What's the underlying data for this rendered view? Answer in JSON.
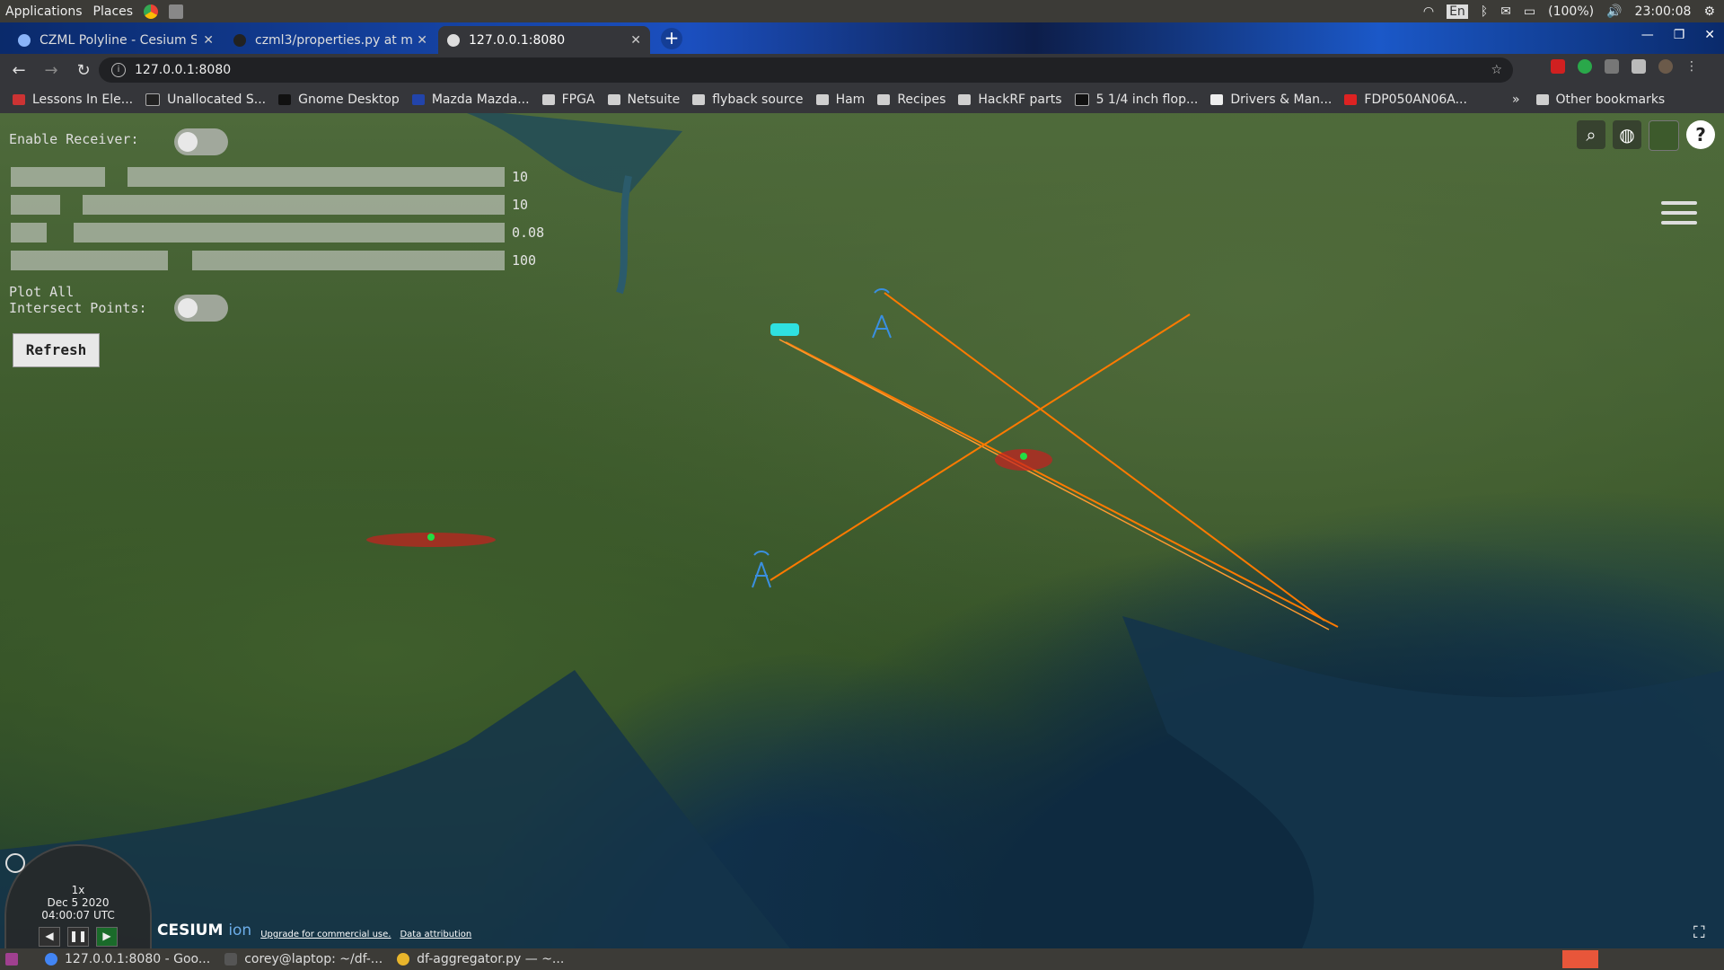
{
  "system_bar": {
    "applications_label": "Applications",
    "places_label": "Places",
    "keyboard_layout": "En",
    "battery": "(100%)",
    "clock": "23:00:08"
  },
  "tabs": [
    {
      "title": "CZML Polyline - Cesium Sa",
      "active": false
    },
    {
      "title": "czml3/properties.py at m",
      "active": false
    },
    {
      "title": "127.0.0.1:8080",
      "active": true
    }
  ],
  "address_bar": {
    "url": "127.0.0.1:8080"
  },
  "bookmarks": [
    {
      "label": "Lessons In Ele..."
    },
    {
      "label": "Unallocated S..."
    },
    {
      "label": "Gnome Desktop"
    },
    {
      "label": "Mazda Mazda..."
    },
    {
      "label": "FPGA"
    },
    {
      "label": "Netsuite"
    },
    {
      "label": "flyback source"
    },
    {
      "label": "Ham"
    },
    {
      "label": "Recipes"
    },
    {
      "label": "HackRF parts"
    },
    {
      "label": "5 1/4 inch flop..."
    },
    {
      "label": "Drivers & Man..."
    },
    {
      "label": "FDP050AN06A..."
    }
  ],
  "bookmarks_overflow": "»",
  "other_bookmarks": "Other bookmarks",
  "panel": {
    "enable_receiver_label": "Enable Receiver:",
    "enable_receiver_on": false,
    "slider_values": [
      "10",
      "10",
      "0.08",
      "100"
    ],
    "plot_all_label_line1": "Plot All",
    "plot_all_label_line2": "Intersect Points:",
    "plot_all_on": false,
    "refresh_label": "Refresh"
  },
  "map_tools": [
    {
      "name": "search-icon",
      "glyph": "⌕"
    },
    {
      "name": "globe-icon",
      "glyph": "◍"
    },
    {
      "name": "imagery-picker-icon",
      "glyph": ""
    },
    {
      "name": "help-icon",
      "glyph": "?"
    }
  ],
  "animation": {
    "speed": "1x",
    "date": "Dec 5 2020",
    "time": "04:00:07 UTC"
  },
  "credits": {
    "logo_text": "CESIUM",
    "logo_ion": "ion",
    "commercial_link": "Upgrade for commercial use.",
    "attribution_link": "Data attribution"
  },
  "taskbar": [
    {
      "label": "127.0.0.1:8080 - Goo...",
      "color": "#4285f4"
    },
    {
      "label": "corey@laptop: ~/df-...",
      "color": "#555555"
    },
    {
      "label": "df-aggregator.py — ~...",
      "color": "#e9b52b"
    }
  ],
  "colors": {
    "bearing_line": "#ff7a00",
    "intersect_ellipse": "#c82020",
    "intersect_point": "#22dd44",
    "receiver_icon": "#3a8fe0",
    "vehicle_icon": "#2fe0e0"
  }
}
